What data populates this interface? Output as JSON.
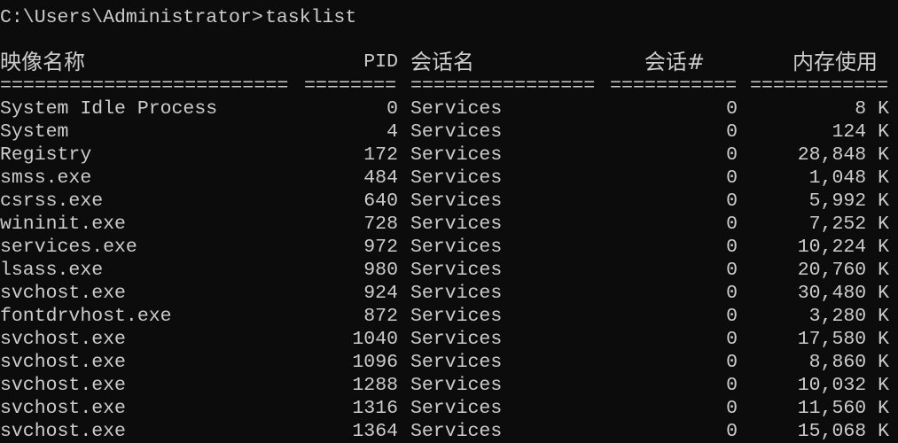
{
  "prompt": {
    "path": "C:\\Users\\Administrator>",
    "command": "tasklist"
  },
  "columns": {
    "image_name": "映像名称",
    "pid": "PID",
    "session_name": "会话名",
    "session_num": "会话#",
    "mem_usage": "内存使用"
  },
  "separators": {
    "image_name": "=========================",
    "pid": "========",
    "session_name": "================",
    "session_num": "===========",
    "mem_usage": "============"
  },
  "rows": [
    {
      "name": "System Idle Process",
      "pid": "0",
      "session": "Services",
      "num": "0",
      "mem": "8 K"
    },
    {
      "name": "System",
      "pid": "4",
      "session": "Services",
      "num": "0",
      "mem": "124 K"
    },
    {
      "name": "Registry",
      "pid": "172",
      "session": "Services",
      "num": "0",
      "mem": "28,848 K"
    },
    {
      "name": "smss.exe",
      "pid": "484",
      "session": "Services",
      "num": "0",
      "mem": "1,048 K"
    },
    {
      "name": "csrss.exe",
      "pid": "640",
      "session": "Services",
      "num": "0",
      "mem": "5,992 K"
    },
    {
      "name": "wininit.exe",
      "pid": "728",
      "session": "Services",
      "num": "0",
      "mem": "7,252 K"
    },
    {
      "name": "services.exe",
      "pid": "972",
      "session": "Services",
      "num": "0",
      "mem": "10,224 K"
    },
    {
      "name": "lsass.exe",
      "pid": "980",
      "session": "Services",
      "num": "0",
      "mem": "20,760 K"
    },
    {
      "name": "svchost.exe",
      "pid": "924",
      "session": "Services",
      "num": "0",
      "mem": "30,480 K"
    },
    {
      "name": "fontdrvhost.exe",
      "pid": "872",
      "session": "Services",
      "num": "0",
      "mem": "3,280 K"
    },
    {
      "name": "svchost.exe",
      "pid": "1040",
      "session": "Services",
      "num": "0",
      "mem": "17,580 K"
    },
    {
      "name": "svchost.exe",
      "pid": "1096",
      "session": "Services",
      "num": "0",
      "mem": "8,860 K"
    },
    {
      "name": "svchost.exe",
      "pid": "1288",
      "session": "Services",
      "num": "0",
      "mem": "10,032 K"
    },
    {
      "name": "svchost.exe",
      "pid": "1316",
      "session": "Services",
      "num": "0",
      "mem": "11,560 K"
    },
    {
      "name": "svchost.exe",
      "pid": "1364",
      "session": "Services",
      "num": "0",
      "mem": "15,068 K"
    }
  ]
}
